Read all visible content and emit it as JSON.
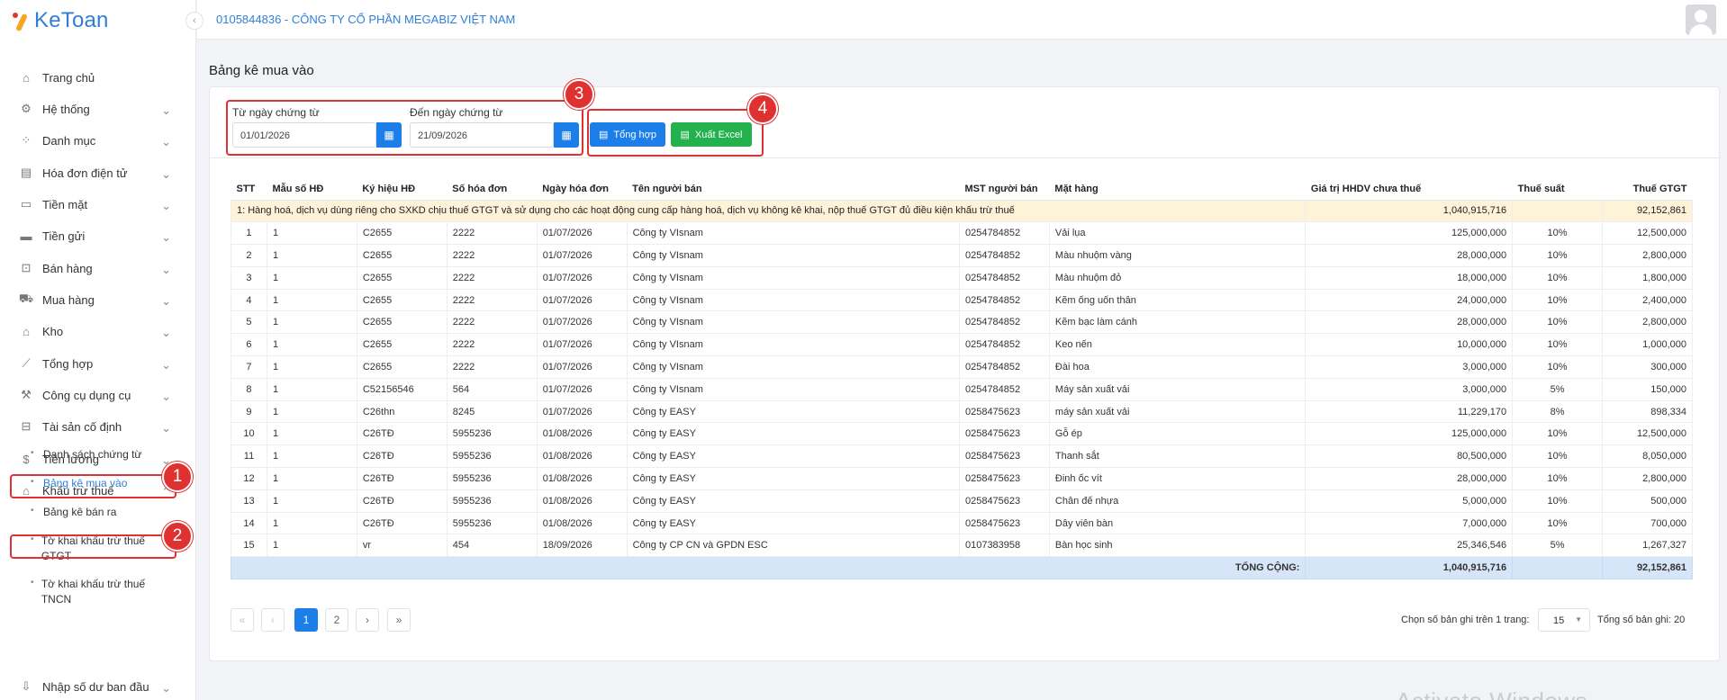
{
  "app": {
    "logo": "KeToan",
    "company": "0105844836 - CÔNG TY CỔ PHẦN MEGABIZ VIỆT NAM"
  },
  "sidebar": {
    "items": [
      {
        "label": "Trang chủ",
        "icon": "home-icon"
      },
      {
        "label": "Hệ thống",
        "icon": "gear-icon"
      },
      {
        "label": "Danh mục",
        "icon": "grid-icon"
      },
      {
        "label": "Hóa đơn điện tử",
        "icon": "invoice-icon"
      },
      {
        "label": "Tiền mặt",
        "icon": "cash-icon"
      },
      {
        "label": "Tiền gửi",
        "icon": "card-icon"
      },
      {
        "label": "Bán hàng",
        "icon": "shopping-bag-icon"
      },
      {
        "label": "Mua hàng",
        "icon": "truck-icon"
      },
      {
        "label": "Kho",
        "icon": "warehouse-icon"
      },
      {
        "label": "Tổng hợp",
        "icon": "chart-line-icon"
      },
      {
        "label": "Công cụ dụng cụ",
        "icon": "tools-icon"
      },
      {
        "label": "Tài sản cố định",
        "icon": "car-icon"
      },
      {
        "label": "Tiền lương",
        "icon": "money-icon"
      },
      {
        "label": "Khấu trừ thuế",
        "icon": "bank-icon"
      }
    ],
    "sub": [
      {
        "label": "Danh sách chứng từ"
      },
      {
        "label": "Bảng kê mua vào"
      },
      {
        "label": "Bảng kê bán ra"
      },
      {
        "label": "Tờ khai khấu trừ thuế GTGT"
      },
      {
        "label": "Tờ khai khấu trừ thuế TNCN"
      }
    ],
    "last": "Nhập số dư ban đầu"
  },
  "annotations": [
    "1",
    "2",
    "3",
    "4"
  ],
  "page": {
    "title": "Bảng kê mua vào"
  },
  "filters": {
    "from_label": "Từ ngày chứng từ",
    "from_value": "01/01/2026",
    "to_label": "Đến ngày chứng từ",
    "to_value": "21/09/2026",
    "summary_btn": "Tổng hợp",
    "excel_btn": "Xuất Excel"
  },
  "table": {
    "headers": [
      "STT",
      "Mẫu số HĐ",
      "Ký hiệu HĐ",
      "Số hóa đơn",
      "Ngày hóa đơn",
      "Tên người bán",
      "MST người bán",
      "Mặt hàng",
      "Giá trị HHDV chưa thuế",
      "Thuế suất",
      "Thuế GTGT"
    ],
    "group": {
      "label": "1: Hàng hoá, dịch vụ dùng riêng cho SXKD chịu thuế GTGT và sử dụng cho các hoạt động cung cấp hàng hoá, dịch vụ không kê khai, nộp thuế GTGT đủ điều kiện khấu trừ thuế",
      "value": "1,040,915,716",
      "tax": "92,152,861"
    },
    "rows": [
      [
        "1",
        "1",
        "C2655",
        "2222",
        "01/07/2026",
        "Công ty VIsnam",
        "0254784852",
        "Vải lụa",
        "125,000,000",
        "10%",
        "12,500,000"
      ],
      [
        "2",
        "1",
        "C2655",
        "2222",
        "01/07/2026",
        "Công ty VIsnam",
        "0254784852",
        "Màu nhuộm vàng",
        "28,000,000",
        "10%",
        "2,800,000"
      ],
      [
        "3",
        "1",
        "C2655",
        "2222",
        "01/07/2026",
        "Công ty VIsnam",
        "0254784852",
        "Màu nhuộm đỏ",
        "18,000,000",
        "10%",
        "1,800,000"
      ],
      [
        "4",
        "1",
        "C2655",
        "2222",
        "01/07/2026",
        "Công ty VIsnam",
        "0254784852",
        "Kẽm ống uốn thân",
        "24,000,000",
        "10%",
        "2,400,000"
      ],
      [
        "5",
        "1",
        "C2655",
        "2222",
        "01/07/2026",
        "Công ty VIsnam",
        "0254784852",
        "Kẽm bạc làm cánh",
        "28,000,000",
        "10%",
        "2,800,000"
      ],
      [
        "6",
        "1",
        "C2655",
        "2222",
        "01/07/2026",
        "Công ty VIsnam",
        "0254784852",
        "Keo nến",
        "10,000,000",
        "10%",
        "1,000,000"
      ],
      [
        "7",
        "1",
        "C2655",
        "2222",
        "01/07/2026",
        "Công ty VIsnam",
        "0254784852",
        "Đài hoa",
        "3,000,000",
        "10%",
        "300,000"
      ],
      [
        "8",
        "1",
        "C52156546",
        "564",
        "01/07/2026",
        "Công ty VIsnam",
        "0254784852",
        "Máy sản xuất vải",
        "3,000,000",
        "5%",
        "150,000"
      ],
      [
        "9",
        "1",
        "C26thn",
        "8245",
        "01/07/2026",
        "Công ty EASY",
        "0258475623",
        "máy sản xuất vải",
        "11,229,170",
        "8%",
        "898,334"
      ],
      [
        "10",
        "1",
        "C26TĐ",
        "5955236",
        "01/08/2026",
        "Công ty EASY",
        "0258475623",
        "Gỗ ép",
        "125,000,000",
        "10%",
        "12,500,000"
      ],
      [
        "11",
        "1",
        "C26TĐ",
        "5955236",
        "01/08/2026",
        "Công ty EASY",
        "0258475623",
        "Thanh sắt",
        "80,500,000",
        "10%",
        "8,050,000"
      ],
      [
        "12",
        "1",
        "C26TĐ",
        "5955236",
        "01/08/2026",
        "Công ty EASY",
        "0258475623",
        "Đinh ốc vít",
        "28,000,000",
        "10%",
        "2,800,000"
      ],
      [
        "13",
        "1",
        "C26TĐ",
        "5955236",
        "01/08/2026",
        "Công ty EASY",
        "0258475623",
        "Chân đế nhựa",
        "5,000,000",
        "10%",
        "500,000"
      ],
      [
        "14",
        "1",
        "C26TĐ",
        "5955236",
        "01/08/2026",
        "Công ty EASY",
        "0258475623",
        "Dây viên bàn",
        "7,000,000",
        "10%",
        "700,000"
      ],
      [
        "15",
        "1",
        "vr",
        "454",
        "18/09/2026",
        "Công ty CP CN và GPDN ESC",
        "0107383958",
        "Bàn học sinh",
        "25,346,546",
        "5%",
        "1,267,327"
      ]
    ],
    "total": {
      "label": "TỔNG CỘNG:",
      "value": "1,040,915,716",
      "tax": "92,152,861"
    }
  },
  "pagination": {
    "first": "«",
    "prev": "‹",
    "pages": [
      "1",
      "2"
    ],
    "next": "›",
    "last": "»",
    "rows_label": "Chọn số bản ghi trên 1 trang:",
    "rows_value": "15",
    "total_label": "Tổng số bản ghi:",
    "total_value": "20"
  },
  "watermark": "Activate Windows"
}
